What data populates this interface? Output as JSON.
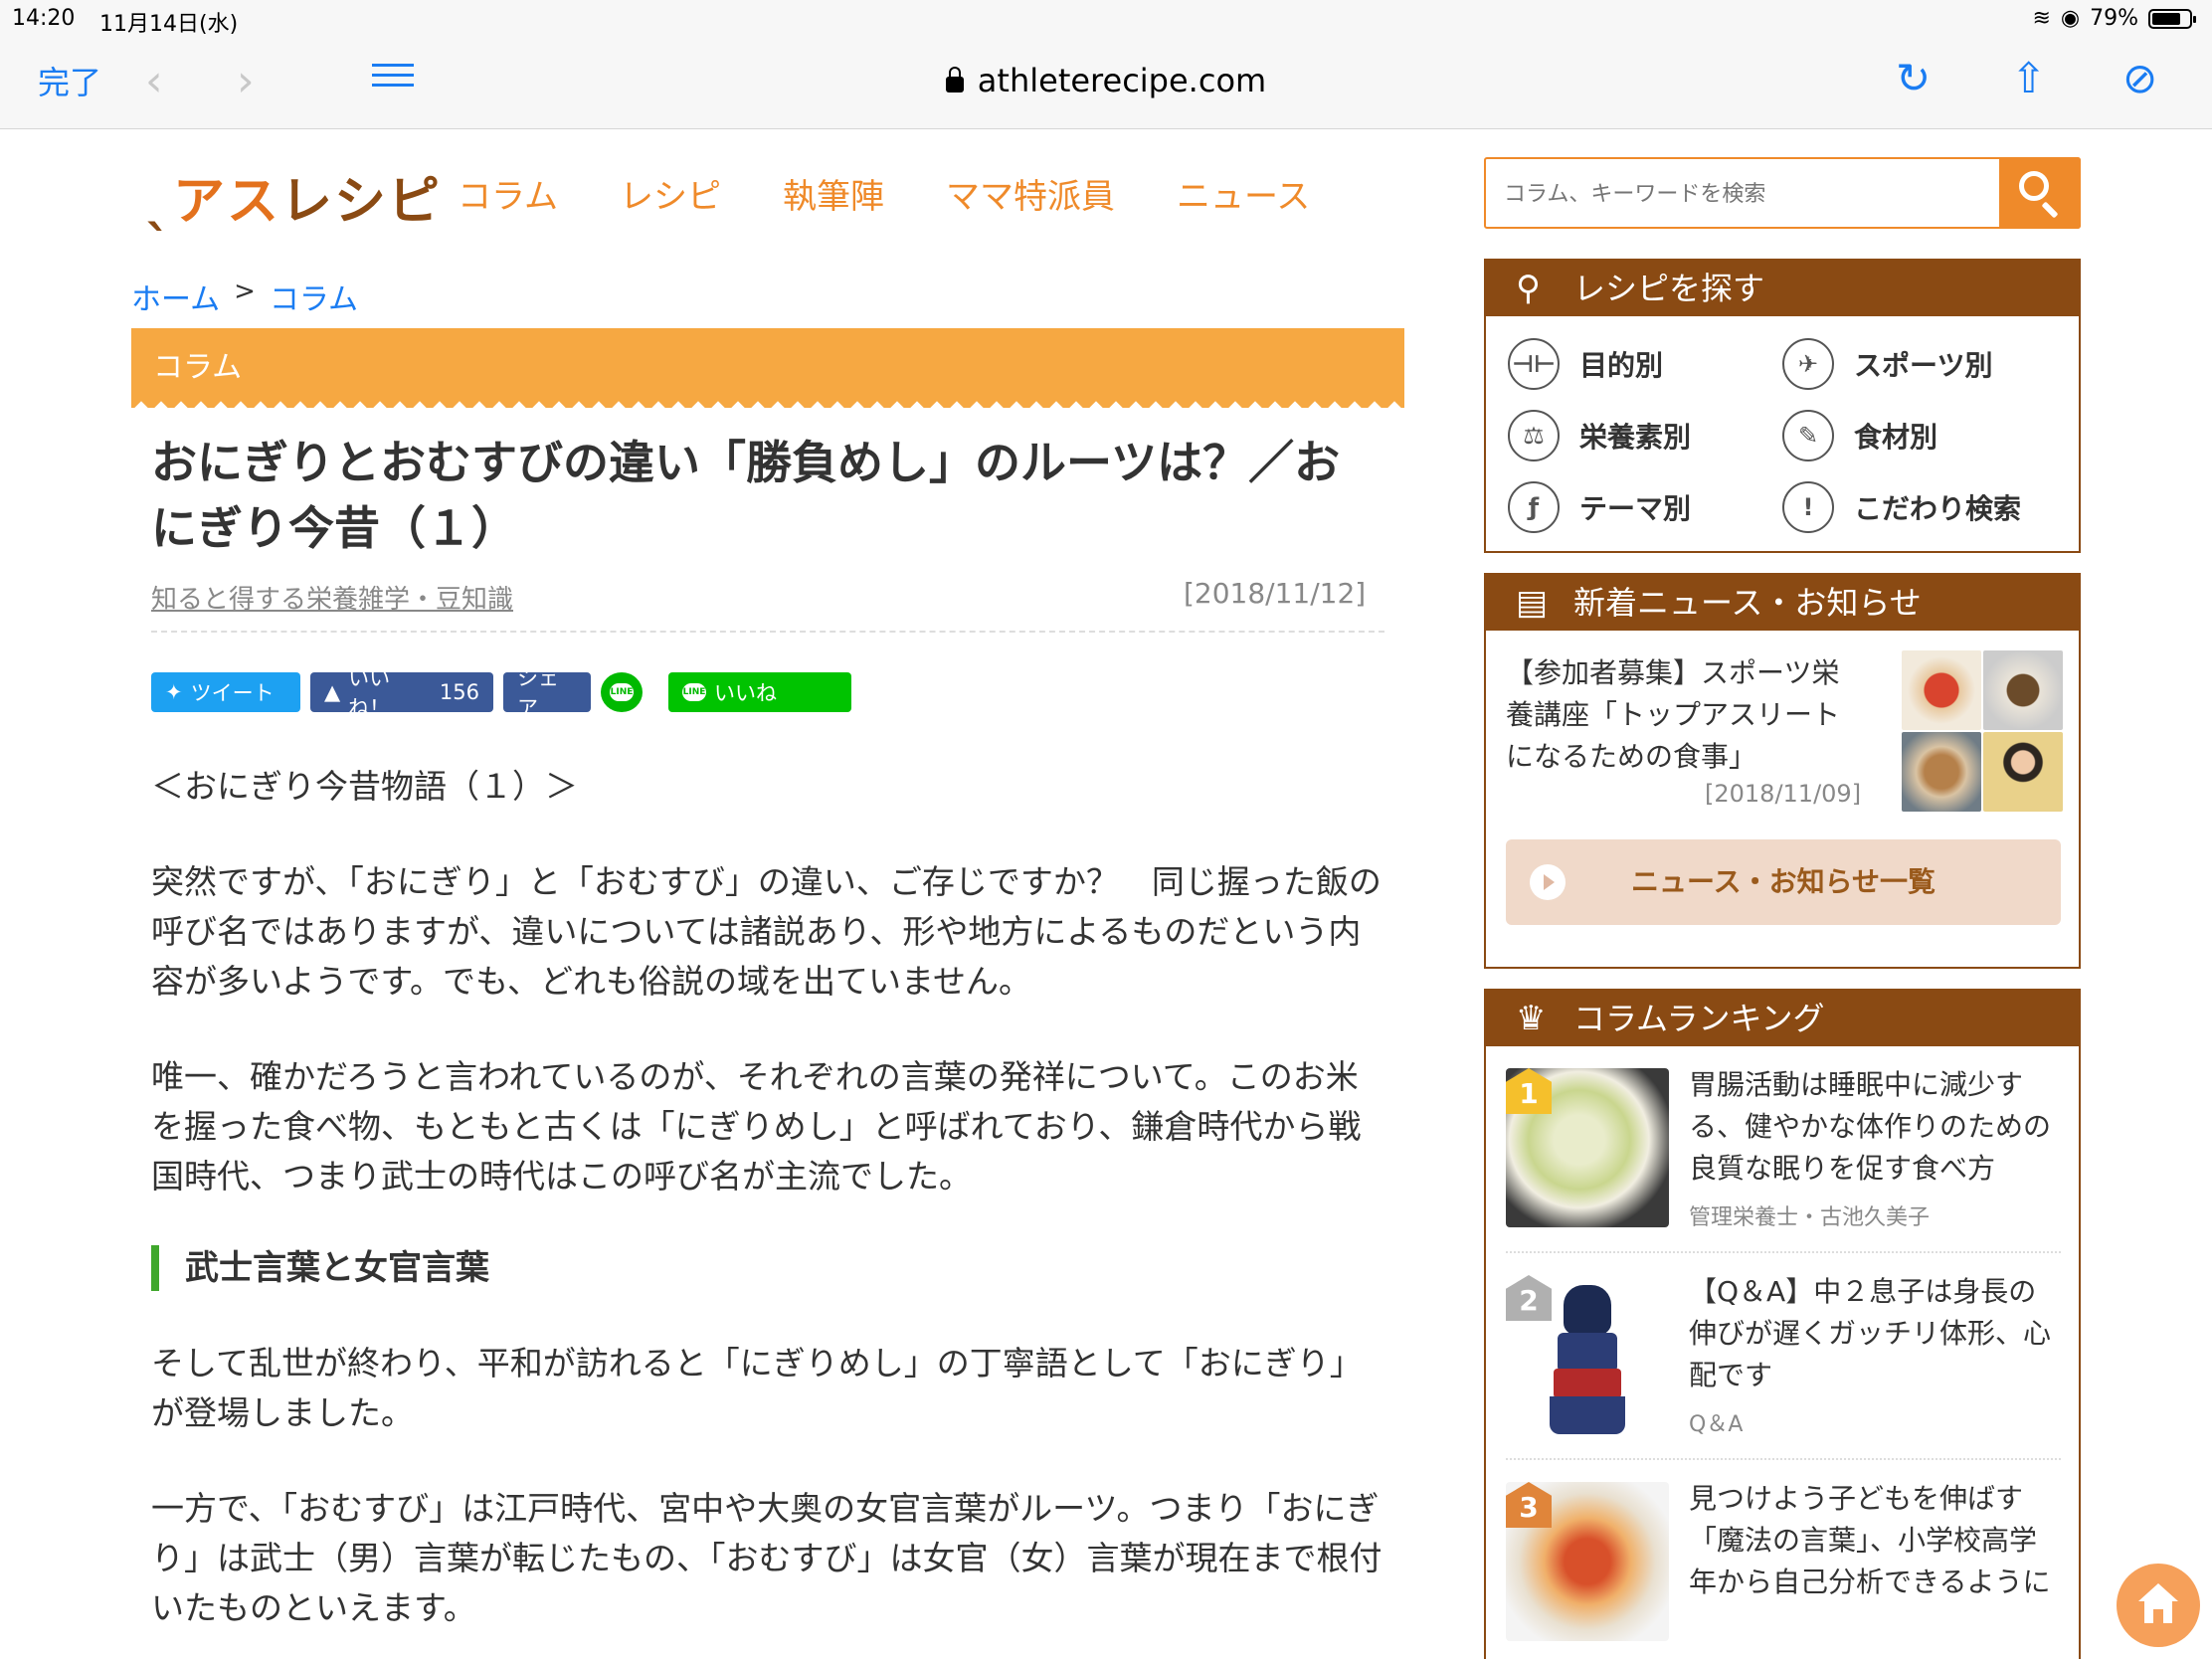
{
  "status_bar": {
    "time": "14:20",
    "date": "11月14日(水)",
    "battery": "79%"
  },
  "browser": {
    "done_label": "完了",
    "back_icon": "‹",
    "forward_icon": "›",
    "url": "athleterecipe.com",
    "reload_icon": "↻",
    "share_icon": "⇧",
    "compass_icon": "⊘"
  },
  "site": {
    "logo_main": "アス",
    "logo_accent": "レシピ",
    "nav": [
      "コラム",
      "レシピ",
      "執筆陣",
      "ママ特派員",
      "ニュース"
    ],
    "search_placeholder": "コラム、キーワードを検索"
  },
  "breadcrumb": {
    "home": "ホーム",
    "separator": ">",
    "current": "コラム"
  },
  "section_label": "コラム",
  "article": {
    "title": "おにぎりとおむすびの違い「勝負めし」のルーツは？／おにぎり今昔（１）",
    "category": "知ると得する栄養雑学・豆知識",
    "date": "[2018/11/12]",
    "share": {
      "tweet": "ツイート",
      "like": "いいね！",
      "like_count": "156",
      "facebook_share": "シェア",
      "line_icon": "LINE",
      "line_like": "いいね"
    },
    "series": "＜おにぎり今昔物語（１）＞",
    "p1": "突然ですが、「おにぎり」と「おむすび」の違い、ご存じですか？　同じ握った飯の呼び名ではありますが、違いについては諸説あり、形や地方によるものだという内容が多いようです。でも、どれも俗説の域を出ていません。",
    "p2": "唯一、確かだろうと言われているのが、それぞれの言葉の発祥について。このお米を握った食べ物、もともと古くは「にぎりめし」と呼ばれており、鎌倉時代から戦国時代、つまり武士の時代はこの呼び名が主流でした。",
    "h2": "武士言葉と女官言葉",
    "p3": "そして乱世が終わり、平和が訪れると「にぎりめし」の丁寧語として「おにぎり」が登場しました。",
    "p4": "一方で、「おむすび」は江戸時代、宮中や大奥の女官言葉がルーツ。つまり「おにぎり」は武士（男）言葉が転じたもの、「おむすび」は女官（女）言葉が現在まで根付いたものといえます。"
  },
  "sidebar": {
    "recipe": {
      "title": "レシピを探す",
      "items": [
        {
          "label": "目的別",
          "icon": "dumbbell-icon",
          "glyph": "⊣⊢"
        },
        {
          "label": "スポーツ別",
          "icon": "runner-icon",
          "glyph": "✈"
        },
        {
          "label": "栄養素別",
          "icon": "scale-icon",
          "glyph": "⚖"
        },
        {
          "label": "食材別",
          "icon": "carrot-icon",
          "glyph": "✎"
        },
        {
          "label": "テーマ別",
          "icon": "fork-icon",
          "glyph": "ƒ"
        },
        {
          "label": "こだわり検索",
          "icon": "exclamation-icon",
          "glyph": "!"
        }
      ]
    },
    "news": {
      "title": "新着ニュース・お知らせ",
      "item_text": "【参加者募集】スポーツ栄養講座「トップアスリートになるための食事」",
      "item_date": "[2018/11/09]",
      "list_button": "ニュース・お知らせ一覧"
    },
    "ranking": {
      "title": "コラムランキング",
      "items": [
        {
          "rank": "1",
          "title": "胃腸活動は睡眠中に減少する、健やかな体作りのための良質な眠りを促す食べ方",
          "author": "管理栄養士・古池久美子"
        },
        {
          "rank": "2",
          "title": "【Q＆A】中２息子は身長の伸びが遅くガッチリ体形、心配です",
          "author": "Q＆A"
        },
        {
          "rank": "3",
          "title": "見つけよう子どもを伸ばす「魔法の言葉」、小学校高学年から自己分析できるように",
          "author": ""
        }
      ]
    }
  }
}
